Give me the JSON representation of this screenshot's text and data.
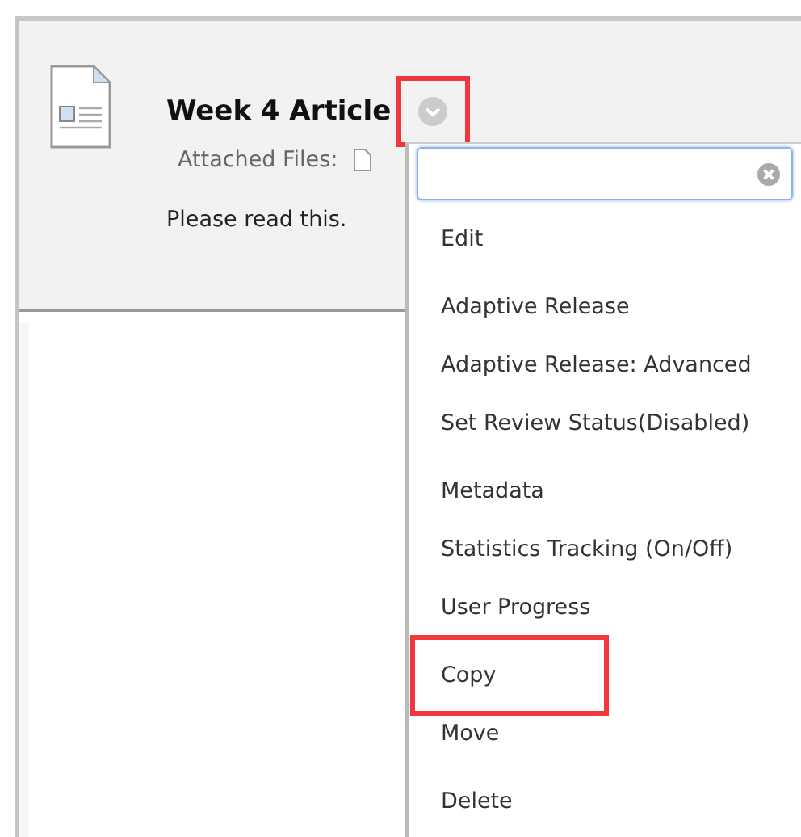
{
  "item": {
    "title": "Week 4 Article",
    "menu_button": {
      "highlighted": true
    },
    "attached_label": "Attached Files:",
    "description": "Please read this."
  },
  "menu": {
    "groups": [
      [
        {
          "label": "Edit",
          "highlighted": false
        }
      ],
      [
        {
          "label": "Adaptive Release",
          "highlighted": false
        },
        {
          "label": "Adaptive Release: Advanced",
          "highlighted": false
        },
        {
          "label": "Set Review Status(Disabled)",
          "highlighted": false
        }
      ],
      [
        {
          "label": "Metadata",
          "highlighted": false
        },
        {
          "label": "Statistics Tracking (On/Off)",
          "highlighted": false
        },
        {
          "label": "User Progress",
          "highlighted": false
        }
      ],
      [
        {
          "label": "Copy",
          "highlighted": true
        },
        {
          "label": "Move",
          "highlighted": false
        }
      ],
      [
        {
          "label": "Delete",
          "highlighted": false
        }
      ]
    ]
  }
}
